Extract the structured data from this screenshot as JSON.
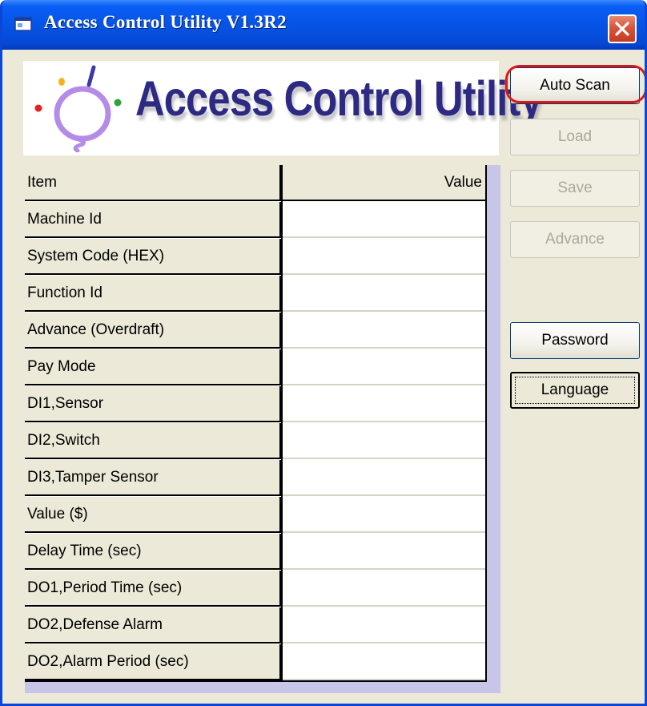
{
  "window": {
    "title": "Access Control Utility V1.3R2"
  },
  "logo": {
    "text": "Access Control Utility"
  },
  "grid": {
    "header": {
      "item": "Item",
      "value": "Value"
    },
    "rows": [
      {
        "item": "Machine Id",
        "value": ""
      },
      {
        "item": "System Code (HEX)",
        "value": ""
      },
      {
        "item": "Function Id",
        "value": ""
      },
      {
        "item": "Advance (Overdraft)",
        "value": ""
      },
      {
        "item": "Pay Mode",
        "value": ""
      },
      {
        "item": "DI1,Sensor",
        "value": ""
      },
      {
        "item": "DI2,Switch",
        "value": ""
      },
      {
        "item": "DI3,Tamper Sensor",
        "value": ""
      },
      {
        "item": "Value ($)",
        "value": ""
      },
      {
        "item": "Delay Time (sec)",
        "value": ""
      },
      {
        "item": "DO1,Period Time (sec)",
        "value": ""
      },
      {
        "item": "DO2,Defense Alarm",
        "value": ""
      },
      {
        "item": "DO2,Alarm Period (sec)",
        "value": ""
      }
    ]
  },
  "buttons": {
    "auto_scan": "Auto Scan",
    "load": "Load",
    "save": "Save",
    "advance": "Advance",
    "password": "Password",
    "language": "Language"
  },
  "colors": {
    "titlebar": "#0654e6",
    "close_button": "#d7553a",
    "logo_text": "#2d2a84",
    "window_bg": "#ece9d8",
    "highlight": "#e01515"
  },
  "icons": {
    "app": "app-window-icon",
    "close": "close-icon",
    "logo": "lightbulb-icon"
  }
}
